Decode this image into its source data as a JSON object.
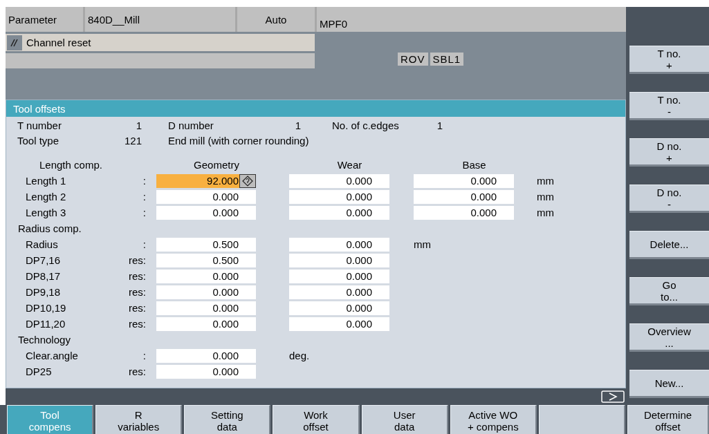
{
  "header": {
    "cells": [
      "Parameter",
      "840D__Mill",
      "Auto",
      "MPF0"
    ]
  },
  "channel_status": {
    "text": "Channel reset"
  },
  "indicators": [
    "ROV",
    "SBL1"
  ],
  "panel": {
    "title": "Tool offsets",
    "info": [
      {
        "cells": [
          "T number",
          "1",
          "D number",
          "1",
          "No. of c.edges",
          "1"
        ]
      },
      {
        "cells": [
          "Tool type",
          "121",
          "End mill (with corner rounding)"
        ]
      }
    ],
    "rows": [
      {
        "kind": "columns",
        "label": "Length comp.",
        "headings": [
          "Geometry",
          "Wear",
          "Base"
        ]
      },
      {
        "kind": "values",
        "label": "Length 1",
        "suffix": ":",
        "fields": [
          {
            "value": "92.000",
            "selected": true
          },
          {
            "value": "0.000",
            "selected": false
          },
          {
            "value": "0.000",
            "selected": false
          }
        ],
        "unit": "mm"
      },
      {
        "kind": "values",
        "label": "Length 2",
        "suffix": ":",
        "fields": [
          {
            "value": "0.000",
            "selected": false
          },
          {
            "value": "0.000",
            "selected": false
          },
          {
            "value": "0.000",
            "selected": false
          }
        ],
        "unit": "mm"
      },
      {
        "kind": "values",
        "label": "Length 3",
        "suffix": ":",
        "fields": [
          {
            "value": "0.000",
            "selected": false
          },
          {
            "value": "0.000",
            "selected": false
          },
          {
            "value": "0.000",
            "selected": false
          }
        ],
        "unit": "mm"
      },
      {
        "kind": "section",
        "label": "Radius comp."
      },
      {
        "kind": "values",
        "label": "Radius",
        "suffix": ":",
        "fields": [
          {
            "value": "0.500",
            "selected": false
          },
          {
            "value": "0.000",
            "selected": false
          }
        ],
        "unit": "mm"
      },
      {
        "kind": "values",
        "label": "DP7,16",
        "suffix": "res:",
        "fields": [
          {
            "value": "0.500",
            "selected": false
          },
          {
            "value": "0.000",
            "selected": false
          }
        ]
      },
      {
        "kind": "values",
        "label": "DP8,17",
        "suffix": "res:",
        "fields": [
          {
            "value": "0.000",
            "selected": false
          },
          {
            "value": "0.000",
            "selected": false
          }
        ]
      },
      {
        "kind": "values",
        "label": "DP9,18",
        "suffix": "res:",
        "fields": [
          {
            "value": "0.000",
            "selected": false
          },
          {
            "value": "0.000",
            "selected": false
          }
        ]
      },
      {
        "kind": "values",
        "label": "DP10,19",
        "suffix": "res:",
        "fields": [
          {
            "value": "0.000",
            "selected": false
          },
          {
            "value": "0.000",
            "selected": false
          }
        ]
      },
      {
        "kind": "values",
        "label": "DP11,20",
        "suffix": "res:",
        "fields": [
          {
            "value": "0.000",
            "selected": false
          },
          {
            "value": "0.000",
            "selected": false
          }
        ]
      },
      {
        "kind": "section",
        "label": "Technology"
      },
      {
        "kind": "values",
        "label": "Clear.angle",
        "suffix": ":",
        "fields": [
          {
            "value": "0.000",
            "selected": false
          }
        ],
        "unit": "deg."
      },
      {
        "kind": "values",
        "label": "DP25",
        "suffix": "res:",
        "fields": [
          {
            "value": "0.000",
            "selected": false
          }
        ]
      }
    ]
  },
  "vertical_softkeys": [
    {
      "lines": [
        "T no.",
        "+"
      ]
    },
    {
      "lines": [
        "T no.",
        "-"
      ]
    },
    {
      "lines": [
        "D no.",
        "+"
      ]
    },
    {
      "lines": [
        "D no.",
        "-"
      ]
    },
    {
      "lines": [
        "Delete..."
      ]
    },
    {
      "lines": [
        "Go",
        "to..."
      ]
    },
    {
      "lines": [
        "Overview",
        "..."
      ]
    },
    {
      "lines": [
        "New..."
      ]
    }
  ],
  "horizontal_softkeys": [
    {
      "lines": [
        "Tool",
        "compens"
      ],
      "selected": true
    },
    {
      "lines": [
        "R",
        "variables"
      ],
      "selected": false
    },
    {
      "lines": [
        "Setting",
        "data"
      ],
      "selected": false
    },
    {
      "lines": [
        "Work",
        "offset"
      ],
      "selected": false
    },
    {
      "lines": [
        "User",
        "data"
      ],
      "selected": false
    },
    {
      "lines": [
        "Active WO",
        "+ compens"
      ],
      "selected": false
    },
    {
      "selected": false
    },
    {
      "lines": [
        "Determine",
        "offset"
      ],
      "selected": false
    }
  ]
}
